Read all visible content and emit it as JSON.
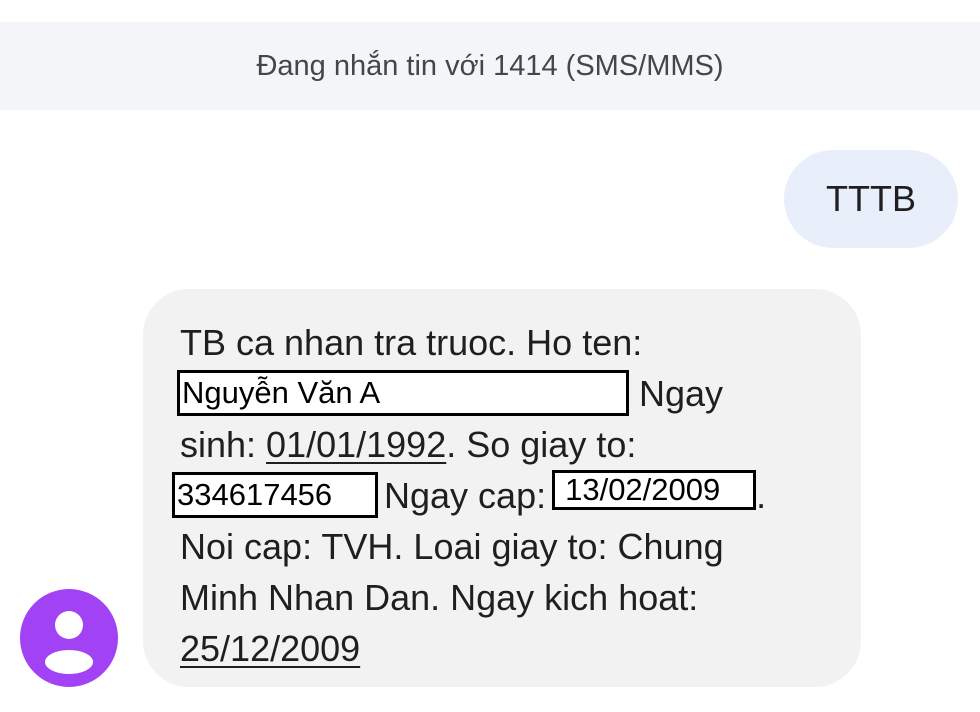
{
  "header": {
    "conversation_title": "Đang nhắn tin với 1414 (SMS/MMS)"
  },
  "messages": {
    "outgoing": {
      "text": "TTTB"
    },
    "incoming": {
      "line1": "TB ca nhan tra truoc. Ho ten:",
      "name_value": "Nguyễn Văn A",
      "line2_suffix": "Ngay",
      "dob_label": "sinh: ",
      "dob_value": "01/01/1992",
      "line3_suffix": ". So giay to:",
      "id_value": "334617456",
      "issue_label": "Ngay cap:",
      "issue_value": "13/02/2009",
      "issue_suffix": ".",
      "line5": "Noi cap: TVH. Loai giay to: Chung",
      "line6": "Minh Nhan Dan. Ngay kich hoat:",
      "activation_value": "25/12/2009"
    }
  },
  "contact": {
    "avatar_icon": "person-icon",
    "avatar_color": "#a142f4"
  },
  "colors": {
    "header_bg": "#f4f5f9",
    "outgoing_bubble": "#e9eefb",
    "incoming_bubble": "#f2f2f2"
  }
}
